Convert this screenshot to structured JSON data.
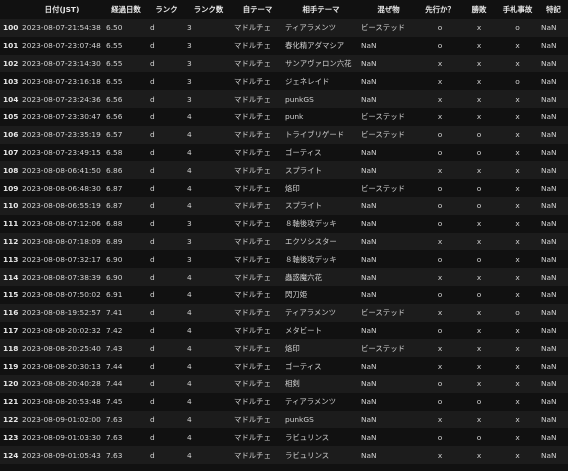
{
  "columns": [
    "",
    "日付(JST)",
    "経過日数",
    "ランク",
    "ランク数",
    "自テーマ",
    "相手テーマ",
    "混ぜ物",
    "先行か？",
    "勝敗",
    "手札事故",
    "特記"
  ],
  "rows": [
    [
      "100",
      "2023-08-07-21:54:38",
      "6.50",
      "d",
      "3",
      "マドルチェ",
      "ティアラメンツ",
      "ビーステッド",
      "o",
      "x",
      "o",
      "NaN"
    ],
    [
      "101",
      "2023-08-07-23:07:48",
      "6.55",
      "d",
      "3",
      "マドルチェ",
      "春化精アダマシア",
      "NaN",
      "o",
      "x",
      "x",
      "NaN"
    ],
    [
      "102",
      "2023-08-07-23:14:30",
      "6.55",
      "d",
      "3",
      "マドルチェ",
      "サンアヴァロン六花",
      "NaN",
      "x",
      "x",
      "x",
      "NaN"
    ],
    [
      "103",
      "2023-08-07-23:16:18",
      "6.55",
      "d",
      "3",
      "マドルチェ",
      "ジェネレイド",
      "NaN",
      "x",
      "x",
      "o",
      "NaN"
    ],
    [
      "104",
      "2023-08-07-23:24:36",
      "6.56",
      "d",
      "3",
      "マドルチェ",
      "punkGS",
      "NaN",
      "x",
      "x",
      "x",
      "NaN"
    ],
    [
      "105",
      "2023-08-07-23:30:47",
      "6.56",
      "d",
      "4",
      "マドルチェ",
      "punk",
      "ビーステッド",
      "x",
      "x",
      "x",
      "NaN"
    ],
    [
      "106",
      "2023-08-07-23:35:19",
      "6.57",
      "d",
      "4",
      "マドルチェ",
      "トライブリゲード",
      "ビーステッド",
      "o",
      "o",
      "x",
      "NaN"
    ],
    [
      "107",
      "2023-08-07-23:49:15",
      "6.58",
      "d",
      "4",
      "マドルチェ",
      "ゴーティス",
      "NaN",
      "o",
      "o",
      "x",
      "NaN"
    ],
    [
      "108",
      "2023-08-08-06:41:50",
      "6.86",
      "d",
      "4",
      "マドルチェ",
      "スプライト",
      "NaN",
      "x",
      "x",
      "x",
      "NaN"
    ],
    [
      "109",
      "2023-08-08-06:48:30",
      "6.87",
      "d",
      "4",
      "マドルチェ",
      "烙印",
      "ビーステッド",
      "o",
      "o",
      "x",
      "NaN"
    ],
    [
      "110",
      "2023-08-08-06:55:19",
      "6.87",
      "d",
      "4",
      "マドルチェ",
      "スプライト",
      "NaN",
      "o",
      "o",
      "x",
      "NaN"
    ],
    [
      "111",
      "2023-08-08-07:12:06",
      "6.88",
      "d",
      "3",
      "マドルチェ",
      "８軸後攻デッキ",
      "NaN",
      "o",
      "x",
      "x",
      "NaN"
    ],
    [
      "112",
      "2023-08-08-07:18:09",
      "6.89",
      "d",
      "3",
      "マドルチェ",
      "エクソシスター",
      "NaN",
      "x",
      "x",
      "x",
      "NaN"
    ],
    [
      "113",
      "2023-08-08-07:32:17",
      "6.90",
      "d",
      "3",
      "マドルチェ",
      "８軸後攻デッキ",
      "NaN",
      "o",
      "o",
      "x",
      "NaN"
    ],
    [
      "114",
      "2023-08-08-07:38:39",
      "6.90",
      "d",
      "4",
      "マドルチェ",
      "蟲惑魔六花",
      "NaN",
      "x",
      "x",
      "x",
      "NaN"
    ],
    [
      "115",
      "2023-08-08-07:50:02",
      "6.91",
      "d",
      "4",
      "マドルチェ",
      "閃刀姫",
      "NaN",
      "o",
      "o",
      "x",
      "NaN"
    ],
    [
      "116",
      "2023-08-08-19:52:57",
      "7.41",
      "d",
      "4",
      "マドルチェ",
      "ティアラメンツ",
      "ビーステッド",
      "x",
      "x",
      "o",
      "NaN"
    ],
    [
      "117",
      "2023-08-08-20:02:32",
      "7.42",
      "d",
      "4",
      "マドルチェ",
      "メタビート",
      "NaN",
      "o",
      "x",
      "x",
      "NaN"
    ],
    [
      "118",
      "2023-08-08-20:25:40",
      "7.43",
      "d",
      "4",
      "マドルチェ",
      "烙印",
      "ビーステッド",
      "x",
      "x",
      "x",
      "NaN"
    ],
    [
      "119",
      "2023-08-08-20:30:13",
      "7.44",
      "d",
      "4",
      "マドルチェ",
      "ゴーティス",
      "NaN",
      "x",
      "x",
      "x",
      "NaN"
    ],
    [
      "120",
      "2023-08-08-20:40:28",
      "7.44",
      "d",
      "4",
      "マドルチェ",
      "相剣",
      "NaN",
      "o",
      "x",
      "x",
      "NaN"
    ],
    [
      "121",
      "2023-08-08-20:53:48",
      "7.45",
      "d",
      "4",
      "マドルチェ",
      "ティアラメンツ",
      "NaN",
      "o",
      "o",
      "x",
      "NaN"
    ],
    [
      "122",
      "2023-08-09-01:02:00",
      "7.63",
      "d",
      "4",
      "マドルチェ",
      "punkGS",
      "NaN",
      "x",
      "x",
      "x",
      "NaN"
    ],
    [
      "123",
      "2023-08-09-01:03:30",
      "7.63",
      "d",
      "4",
      "マドルチェ",
      "ラビュリンス",
      "NaN",
      "o",
      "o",
      "x",
      "NaN"
    ],
    [
      "124",
      "2023-08-09-01:05:43",
      "7.63",
      "d",
      "4",
      "マドルチェ",
      "ラビュリンス",
      "NaN",
      "x",
      "x",
      "x",
      "NaN"
    ]
  ]
}
